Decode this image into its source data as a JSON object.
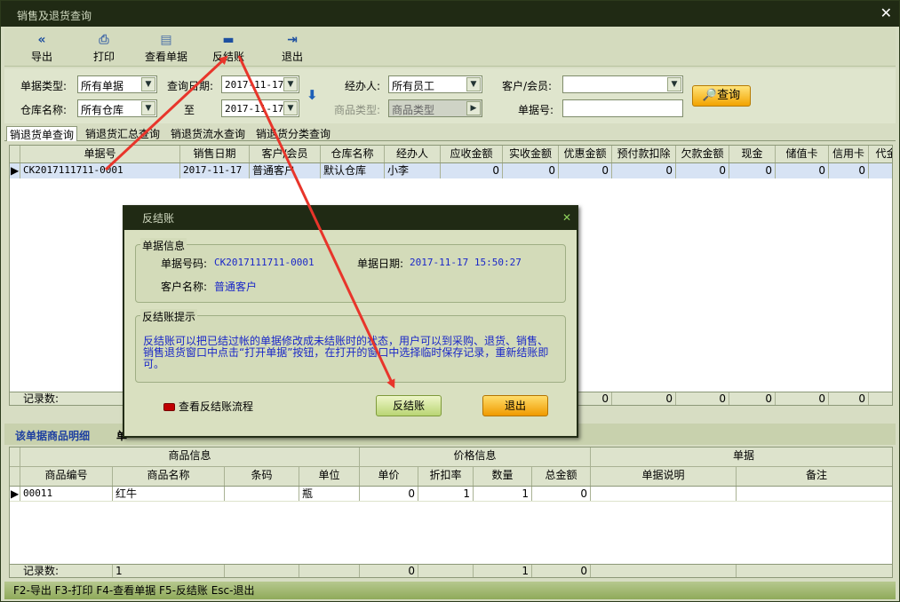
{
  "window": {
    "title": "销售及退货查询",
    "close": "✕"
  },
  "toolbar": [
    {
      "label": "导出",
      "icon": "double-left-arrow-icon",
      "glyph": "«"
    },
    {
      "label": "打印",
      "icon": "printer-icon",
      "glyph": "⎙"
    },
    {
      "label": "查看单据",
      "icon": "document-view-icon",
      "glyph": "▤"
    },
    {
      "label": "反结账",
      "icon": "minus-icon",
      "glyph": "▬"
    },
    {
      "label": "退出",
      "icon": "exit-door-icon",
      "glyph": "⇥"
    }
  ],
  "filters": {
    "doc_type_label": "单据类型:",
    "doc_type_value": "所有单据",
    "query_date_label": "查询日期:",
    "date_from": "2017-11-17",
    "to_label": "至",
    "date_to": "2017-11-17",
    "handler_label": "经办人:",
    "handler_value": "所有员工",
    "customer_label": "客户/会员:",
    "customer_value": "",
    "warehouse_label": "仓库名称:",
    "warehouse_value": "所有仓库",
    "goods_type_label": "商品类型:",
    "goods_type_value": "商品类型",
    "doc_no_label": "单据号:",
    "doc_no_value": "",
    "query_button": "查询"
  },
  "tabs": [
    "销退货单查询",
    "销退货汇总查询",
    "销退货流水查询",
    "销退货分类查询"
  ],
  "grid1": {
    "columns": [
      "单据号",
      "销售日期",
      "客户/会员",
      "仓库名称",
      "经办人",
      "应收金额",
      "实收金额",
      "优惠金额",
      "预付款扣除",
      "欠款金额",
      "现金",
      "储值卡",
      "信用卡",
      "代金"
    ],
    "rows": [
      [
        "CK2017111711-0001",
        "2017-11-17 15",
        "普通客户",
        "默认仓库",
        "小李",
        "0",
        "0",
        "0",
        "0",
        "0",
        "0",
        "0",
        "0",
        ""
      ]
    ],
    "footer_label": "记录数:",
    "footer_values": [
      "0",
      "0",
      "0",
      "0",
      "0",
      "0"
    ]
  },
  "detail_bar": {
    "title": "该单据商品明细",
    "partial": "单"
  },
  "grid2": {
    "groups": [
      "商品信息",
      "价格信息",
      "单据"
    ],
    "columns": [
      "商品编号",
      "商品名称",
      "条码",
      "单位",
      "单价",
      "折扣率",
      "数量",
      "总金额",
      "单据说明",
      "备注"
    ],
    "rows": [
      [
        "00011",
        "红牛",
        "",
        "瓶",
        "0",
        "1",
        "1",
        "0",
        "",
        ""
      ]
    ],
    "footer_label": "记录数:",
    "footer_values": [
      "1",
      "",
      "",
      "0",
      "",
      "1",
      "0",
      "",
      ""
    ]
  },
  "statusbar": "F2-导出 F3-打印 F4-查看单据 F5-反结账 Esc-退出",
  "modal": {
    "title": "反结账",
    "close": "✕",
    "info_group": "单据信息",
    "doc_no_label": "单据号码:",
    "doc_no": "CK2017111711-0001",
    "doc_date_label": "单据日期:",
    "doc_date": "2017-11-17 15:50:27",
    "customer_label": "客户名称:",
    "customer": "普通客户",
    "hint_group": "反结账提示",
    "hint": "反结账可以把已结过帐的单据修改成未结账时的状态，用户可以到采购、退货、销售、销售退货窗口中点击“打开单据”按钮，在打开的窗口中选择临时保存记录，重新结账即可。",
    "flow_link": "查看反结账流程",
    "confirm_button": "反结账",
    "exit_button": "退出"
  },
  "colors": {
    "titlebar": "#202a14",
    "panel": "#d7ddc3",
    "accent_orange": "#f2a300",
    "link_blue": "#1a27c8",
    "annotation_red": "#e8352b"
  }
}
